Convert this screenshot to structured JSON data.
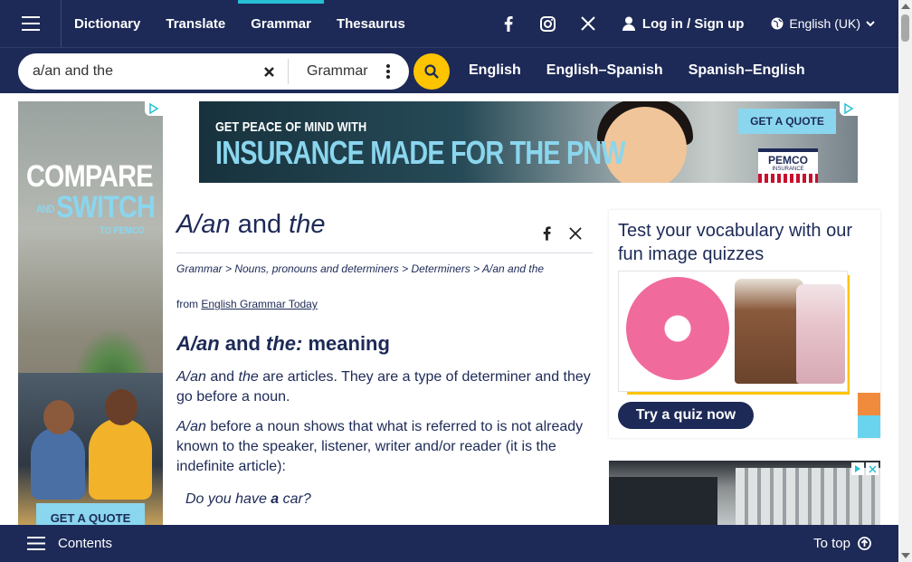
{
  "nav": {
    "links": [
      {
        "label": "Dictionary",
        "active": false
      },
      {
        "label": "Translate",
        "active": false
      },
      {
        "label": "Grammar",
        "active": true
      },
      {
        "label": "Thesaurus",
        "active": false
      }
    ],
    "social_icons": [
      "facebook-icon",
      "instagram-icon",
      "x-icon"
    ],
    "login_label": "Log in / Sign up",
    "language_label": "English (UK)"
  },
  "search": {
    "value": "a/an and the",
    "dictionary": "Grammar",
    "dict_links": [
      "English",
      "English–Spanish",
      "Spanish–English"
    ]
  },
  "ads": {
    "left": {
      "line1": "COMPARE",
      "line2_small": "AND",
      "line2": "SWITCH",
      "line3": "TO PEMCO",
      "cta": "GET A QUOTE"
    },
    "top": {
      "small": "GET PEACE OF MIND WITH",
      "big": "INSURANCE MADE FOR THE PNW",
      "cta": "GET A QUOTE",
      "logo": "PEMCO",
      "logo_sub": "INSURANCE"
    }
  },
  "article": {
    "title_italic": "A/an",
    "title_rest": " and ",
    "title_italic2": "the",
    "breadcrumb": "Grammar > Nouns, pronouns and determiners > Determiners > A/an and the",
    "from_prefix": "from ",
    "from_link": "English Grammar Today",
    "heading_italic1": "A/an",
    "heading_mid": " and ",
    "heading_italic2": "the:",
    "heading_rest": " meaning",
    "p1_italic1": "A/an",
    "p1_mid": " and ",
    "p1_italic2": "the",
    "p1_rest": " are articles. They are a type of determiner and they go before a noun.",
    "p2_italic": "A/an",
    "p2_rest": " before a noun shows that what is referred to is not already known to the speaker, listener, writer and/or reader (it is the indefinite article):",
    "example_pre": "Do you have ",
    "example_bold": "a",
    "example_post": " car?"
  },
  "quiz": {
    "title": "Test your vocabulary with our fun image quizzes",
    "button": "Try a quiz now"
  },
  "bottom": {
    "contents_label": "Contents",
    "totop_label": "To top"
  },
  "colors": {
    "navy": "#1d2a57",
    "accent_yellow": "#fec400",
    "accent_cyan": "#27c0d3"
  }
}
